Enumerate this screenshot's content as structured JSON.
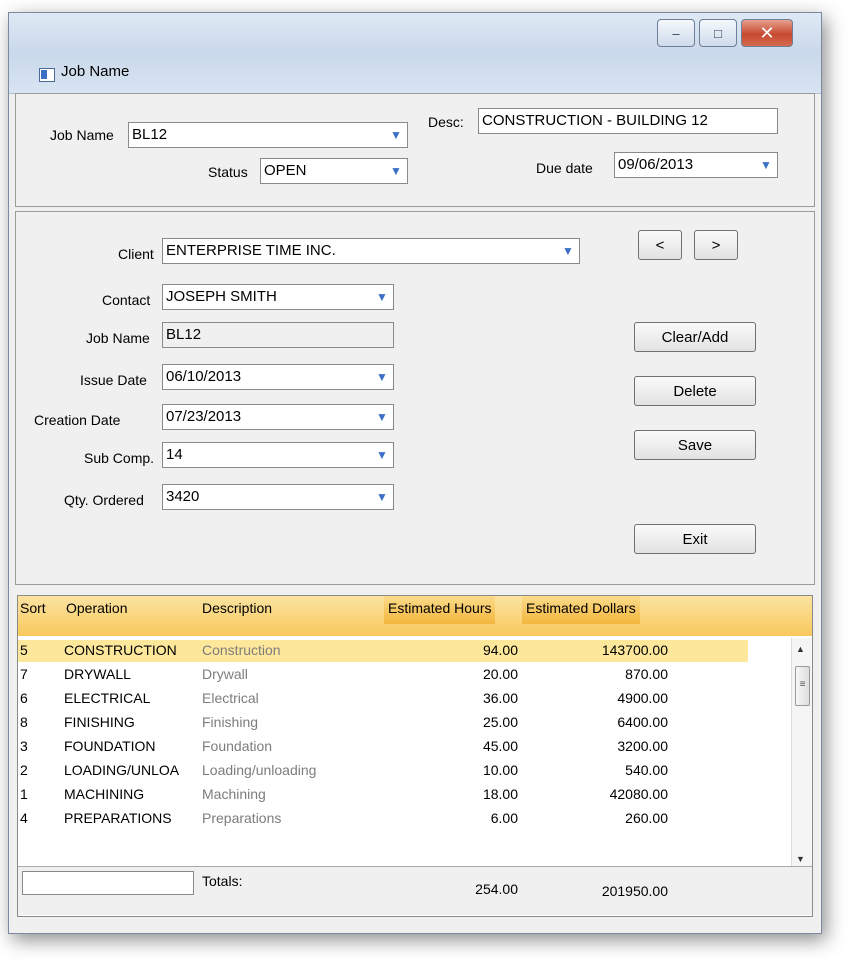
{
  "window": {
    "title": "Job Name",
    "controls": {
      "minimize": "–",
      "maximize": "□",
      "close": "✕"
    }
  },
  "header": {
    "job_name_label": "Job Name",
    "job_name_value": "BL12",
    "desc_label": "Desc:",
    "desc_value": "CONSTRUCTION - BUILDING 12",
    "status_label": "Status",
    "status_value": "OPEN",
    "due_date_label": "Due date",
    "due_date_value": "09/06/2013"
  },
  "details": {
    "client_label": "Client",
    "client_value": "ENTERPRISE TIME INC.",
    "contact_label": "Contact",
    "contact_value": "JOSEPH SMITH",
    "job_name_label": "Job Name",
    "job_name_value": "BL12",
    "issue_date_label": "Issue Date",
    "issue_date_value": "06/10/2013",
    "creation_date_label": "Creation Date",
    "creation_date_value": "07/23/2013",
    "sub_comp_label": "Sub Comp.",
    "sub_comp_value": "14",
    "qty_label": "Qty. Ordered",
    "qty_value": "3420"
  },
  "buttons": {
    "prev": "<",
    "next": ">",
    "clear_add": "Clear/Add",
    "delete": "Delete",
    "save": "Save",
    "exit": "Exit"
  },
  "grid": {
    "headers": {
      "sort": "Sort",
      "operation": "Operation",
      "description": "Description",
      "hours": "Estimated Hours",
      "dollars": "Estimated Dollars"
    },
    "rows": [
      {
        "sort": "5",
        "operation": "CONSTRUCTION",
        "description": "Construction",
        "hours": "94.00",
        "dollars": "143700.00"
      },
      {
        "sort": "7",
        "operation": "DRYWALL",
        "description": "Drywall",
        "hours": "20.00",
        "dollars": "870.00"
      },
      {
        "sort": "6",
        "operation": "ELECTRICAL",
        "description": "Electrical",
        "hours": "36.00",
        "dollars": "4900.00"
      },
      {
        "sort": "8",
        "operation": "FINISHING",
        "description": "Finishing",
        "hours": "25.00",
        "dollars": "6400.00"
      },
      {
        "sort": "3",
        "operation": "FOUNDATION",
        "description": "Foundation",
        "hours": "45.00",
        "dollars": "3200.00"
      },
      {
        "sort": "2",
        "operation": "LOADING/UNLOA",
        "description": "Loading/unloading",
        "hours": "10.00",
        "dollars": "540.00"
      },
      {
        "sort": "1",
        "operation": "MACHINING",
        "description": "Machining",
        "hours": "18.00",
        "dollars": "42080.00"
      },
      {
        "sort": "4",
        "operation": "PREPARATIONS",
        "description": "Preparations",
        "hours": "6.00",
        "dollars": "260.00"
      }
    ],
    "totals_label": "Totals:",
    "total_hours": "254.00",
    "total_dollars": "201950.00"
  }
}
